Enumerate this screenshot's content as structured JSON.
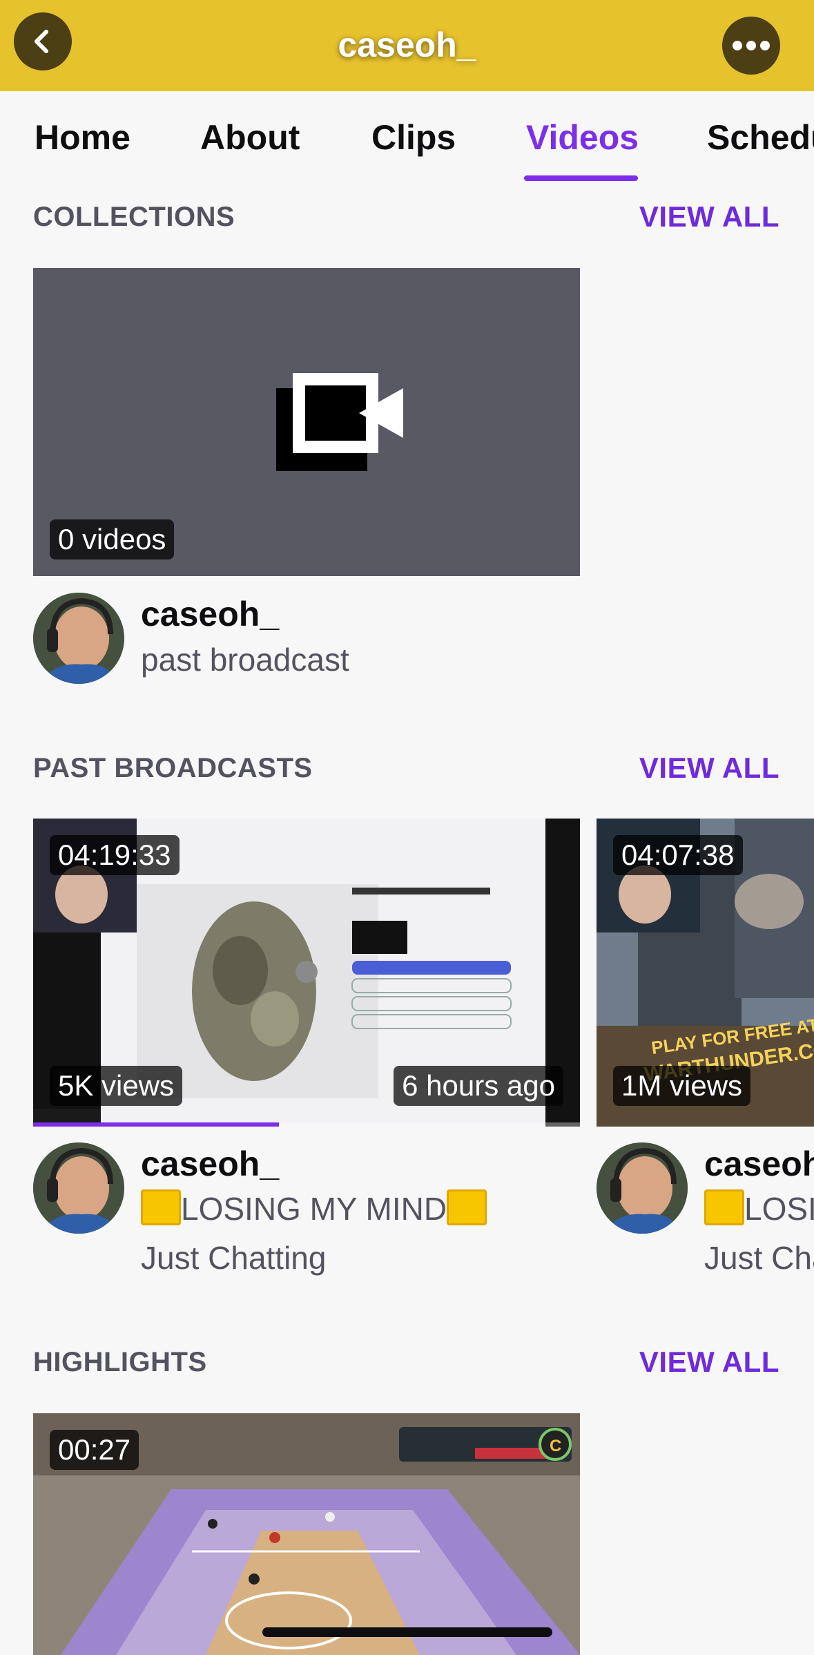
{
  "header": {
    "title": "caseoh_",
    "color": "#e6c22d"
  },
  "tabs": [
    {
      "label": "Home",
      "active": false
    },
    {
      "label": "About",
      "active": false
    },
    {
      "label": "Clips",
      "active": false
    },
    {
      "label": "Videos",
      "active": true
    },
    {
      "label": "Schedule",
      "active": false
    }
  ],
  "collections": {
    "title": "COLLECTIONS",
    "view_all": "VIEW ALL",
    "items": [
      {
        "count_badge": "0 videos",
        "channel": "caseoh_",
        "subtitle": "past broadcast"
      }
    ]
  },
  "past_broadcasts": {
    "title": "PAST BROADCASTS",
    "view_all": "VIEW ALL",
    "items": [
      {
        "duration": "04:19:33",
        "views": "5K views",
        "age": "6 hours ago",
        "channel": "caseoh_",
        "title": "LOSING MY MIND",
        "category": "Just Chatting",
        "progress": 0.45
      },
      {
        "duration": "04:07:38",
        "views": "1M views",
        "age": "",
        "channel": "caseoh_",
        "title": "LOSING MY MIND",
        "category": "Just Chatting",
        "progress": 0
      }
    ]
  },
  "highlights": {
    "title": "HIGHLIGHTS",
    "view_all": "VIEW ALL",
    "items": [
      {
        "duration": "00:27"
      }
    ]
  },
  "accent_color": "#7d2ee8"
}
